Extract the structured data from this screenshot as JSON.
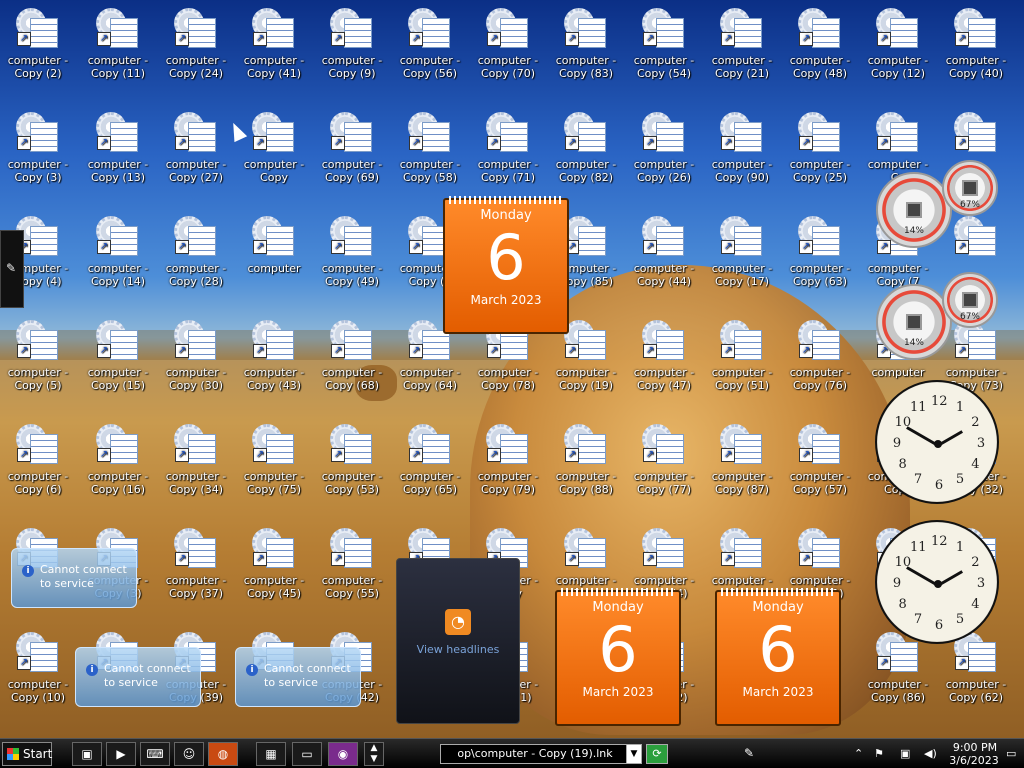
{
  "icons": [
    "computer - Copy (2)",
    "computer - Copy (11)",
    "computer - Copy (24)",
    "computer - Copy (41)",
    "computer - Copy (9)",
    "computer - Copy (56)",
    "computer - Copy (70)",
    "computer - Copy (83)",
    "computer - Copy (54)",
    "computer - Copy (21)",
    "computer - Copy (48)",
    "computer - Copy (12)",
    "computer - Copy (40)",
    "computer - Copy (3)",
    "computer - Copy (13)",
    "computer - Copy (27)",
    "computer - Copy",
    "computer - Copy (69)",
    "computer - Copy (58)",
    "computer - Copy (71)",
    "computer - Copy (82)",
    "computer - Copy (26)",
    "computer - Copy (90)",
    "computer - Copy (25)",
    "computer - Co",
    "",
    "computer - Copy (4)",
    "computer - Copy (14)",
    "computer - Copy (28)",
    "computer",
    "computer - Copy (49)",
    "computer - Copy (5",
    "",
    "computer - Copy (85)",
    "computer - Copy (44)",
    "computer - Copy (17)",
    "computer - Copy (63)",
    "computer - Copy (7",
    "",
    "computer - Copy (5)",
    "computer - Copy (15)",
    "computer - Copy (30)",
    "computer - Copy (43)",
    "computer - Copy (68)",
    "computer - Copy (64)",
    "computer - Copy (78)",
    "computer - Copy (19)",
    "computer - Copy (47)",
    "computer - Copy (51)",
    "computer - Copy (76)",
    "computer",
    "computer - Copy (73)",
    "computer - Copy (6)",
    "computer - Copy (16)",
    "computer - Copy (34)",
    "computer - Copy (75)",
    "computer - Copy (53)",
    "computer - Copy (65)",
    "computer - Copy (79)",
    "computer - Copy (88)",
    "computer - Copy (77)",
    "computer - Copy (87)",
    "computer - Copy (57)",
    "computer - Copy",
    "computer - Copy (32)",
    "",
    "computer - Copy (3)",
    "computer - Copy (37)",
    "computer - Copy (45)",
    "computer - Copy (55)",
    "",
    "computer - Copy",
    "computer - Copy",
    "computer - Copy (4)",
    "computer - Copy",
    "computer - Copy (1)",
    "",
    "",
    "computer - Copy (10)",
    "",
    "computer - Copy (39)",
    "",
    "computer - Copy (42)",
    "",
    "computer - Copy (1)",
    "",
    "computer - Copy (2)",
    "",
    "",
    "computer - Copy (86)",
    "computer - Copy (62)"
  ],
  "gadgets": {
    "notice_text": "Cannot connect to service",
    "notice_icon": "info-icon",
    "calendar": {
      "weekday": "Monday",
      "day": "6",
      "month_year": "March 2023"
    },
    "meter_a": {
      "cpu": "14%",
      "mem": "67%"
    },
    "rss_label": "View headlines",
    "rss_icon": "rss-icon"
  },
  "taskbar": {
    "start_label": "Start",
    "address_text": "op\\computer - Copy (19).lnk",
    "clock_time": "9:00 PM",
    "clock_date": "3/6/2023"
  }
}
